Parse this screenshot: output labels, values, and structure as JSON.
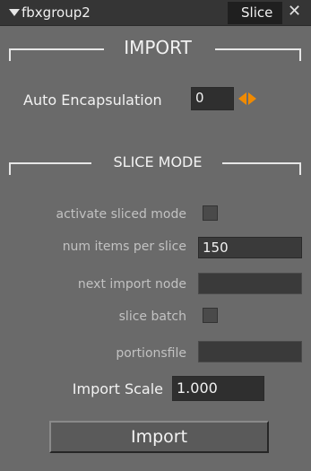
{
  "titlebar": {
    "title": "fbxgroup2",
    "tab_label": "Slice",
    "close_glyph": "✕"
  },
  "import_section": {
    "title": "IMPORT",
    "auto_encapsulation_label": "Auto Encapsulation",
    "auto_encapsulation_value": "0"
  },
  "slice_section": {
    "title": "SLICE MODE",
    "activate_label": "activate sliced mode",
    "activate_checked": false,
    "num_items_label": "num items per slice",
    "num_items_value": "150",
    "next_import_label": "next import node",
    "next_import_value": "",
    "slice_batch_label": "slice batch",
    "slice_batch_checked": false,
    "portionsfile_label": "portionsfile",
    "portionsfile_value": ""
  },
  "import_scale": {
    "label": "Import Scale",
    "value": "1.000"
  },
  "import_button": {
    "label": "Import"
  },
  "colors": {
    "background": "#6a6a6a",
    "titlebar": "#353535",
    "accent_orange": "#f08a00",
    "field_bg": "#3a3a3a"
  },
  "icons": {
    "collapse": "triangle-down-icon",
    "close": "close-icon",
    "stepper": "orange-left-right-arrows-icon"
  }
}
